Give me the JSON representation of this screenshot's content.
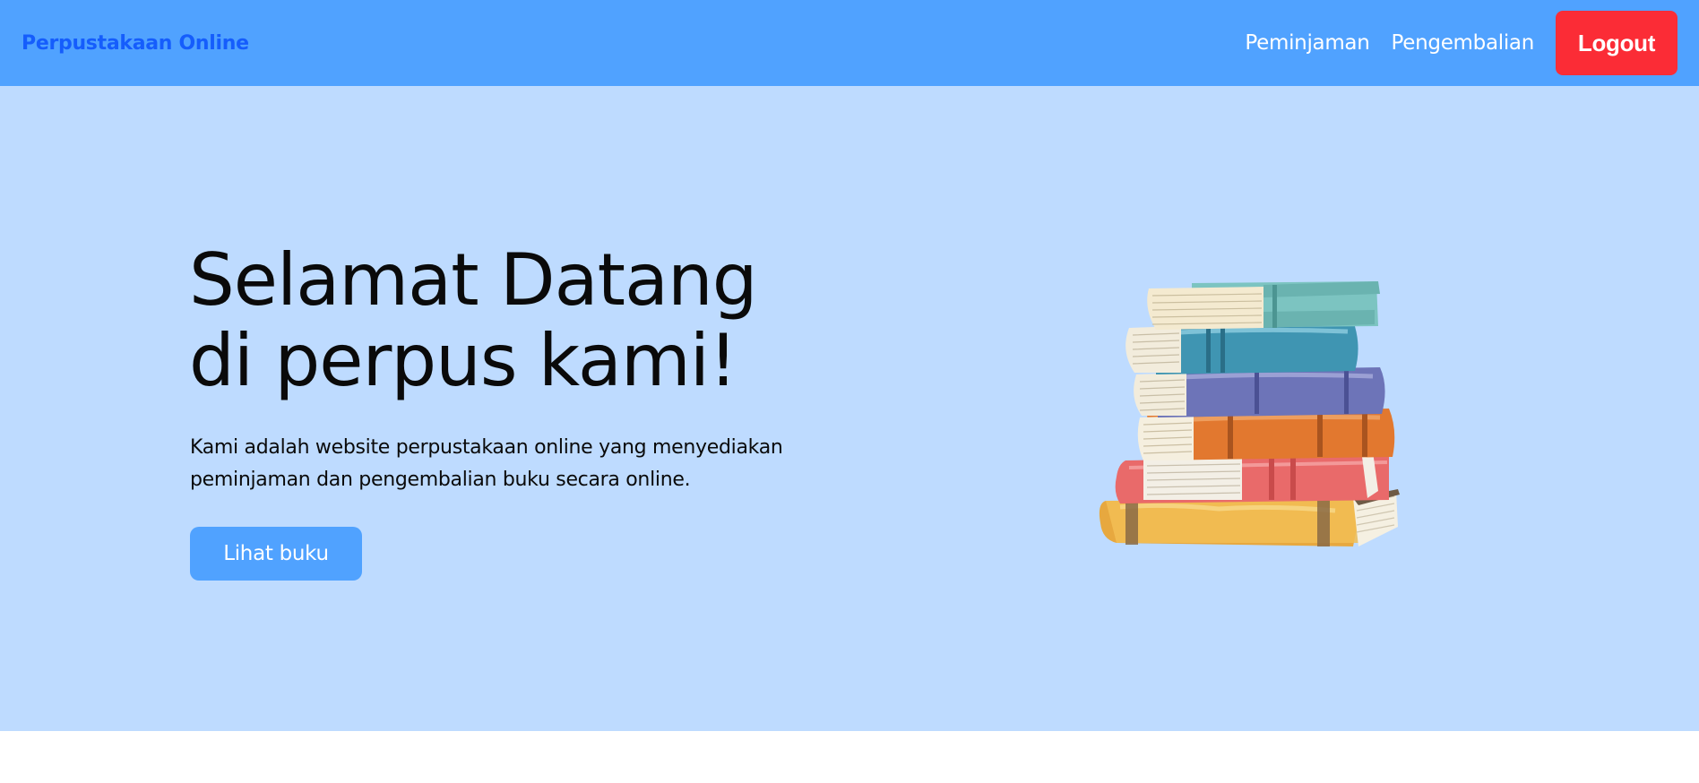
{
  "navbar": {
    "brand": "Perpustakaan Online",
    "links": [
      "Peminjaman",
      "Pengembalian"
    ],
    "logout_label": "Logout",
    "colors": {
      "background": "#50a2ff",
      "brand": "#155dfc",
      "logout": "#fb2c36"
    }
  },
  "hero": {
    "title_lines": [
      "Selamat Datang",
      "di perpus kami!"
    ],
    "description_lines": [
      "Kami adalah website perpustakaan online yang menyediakan",
      "peminjaman dan pengembalian buku secara online."
    ],
    "cta_label": "Lihat buku",
    "illustration": "book-stack-illustration",
    "background": "#bedbff"
  }
}
